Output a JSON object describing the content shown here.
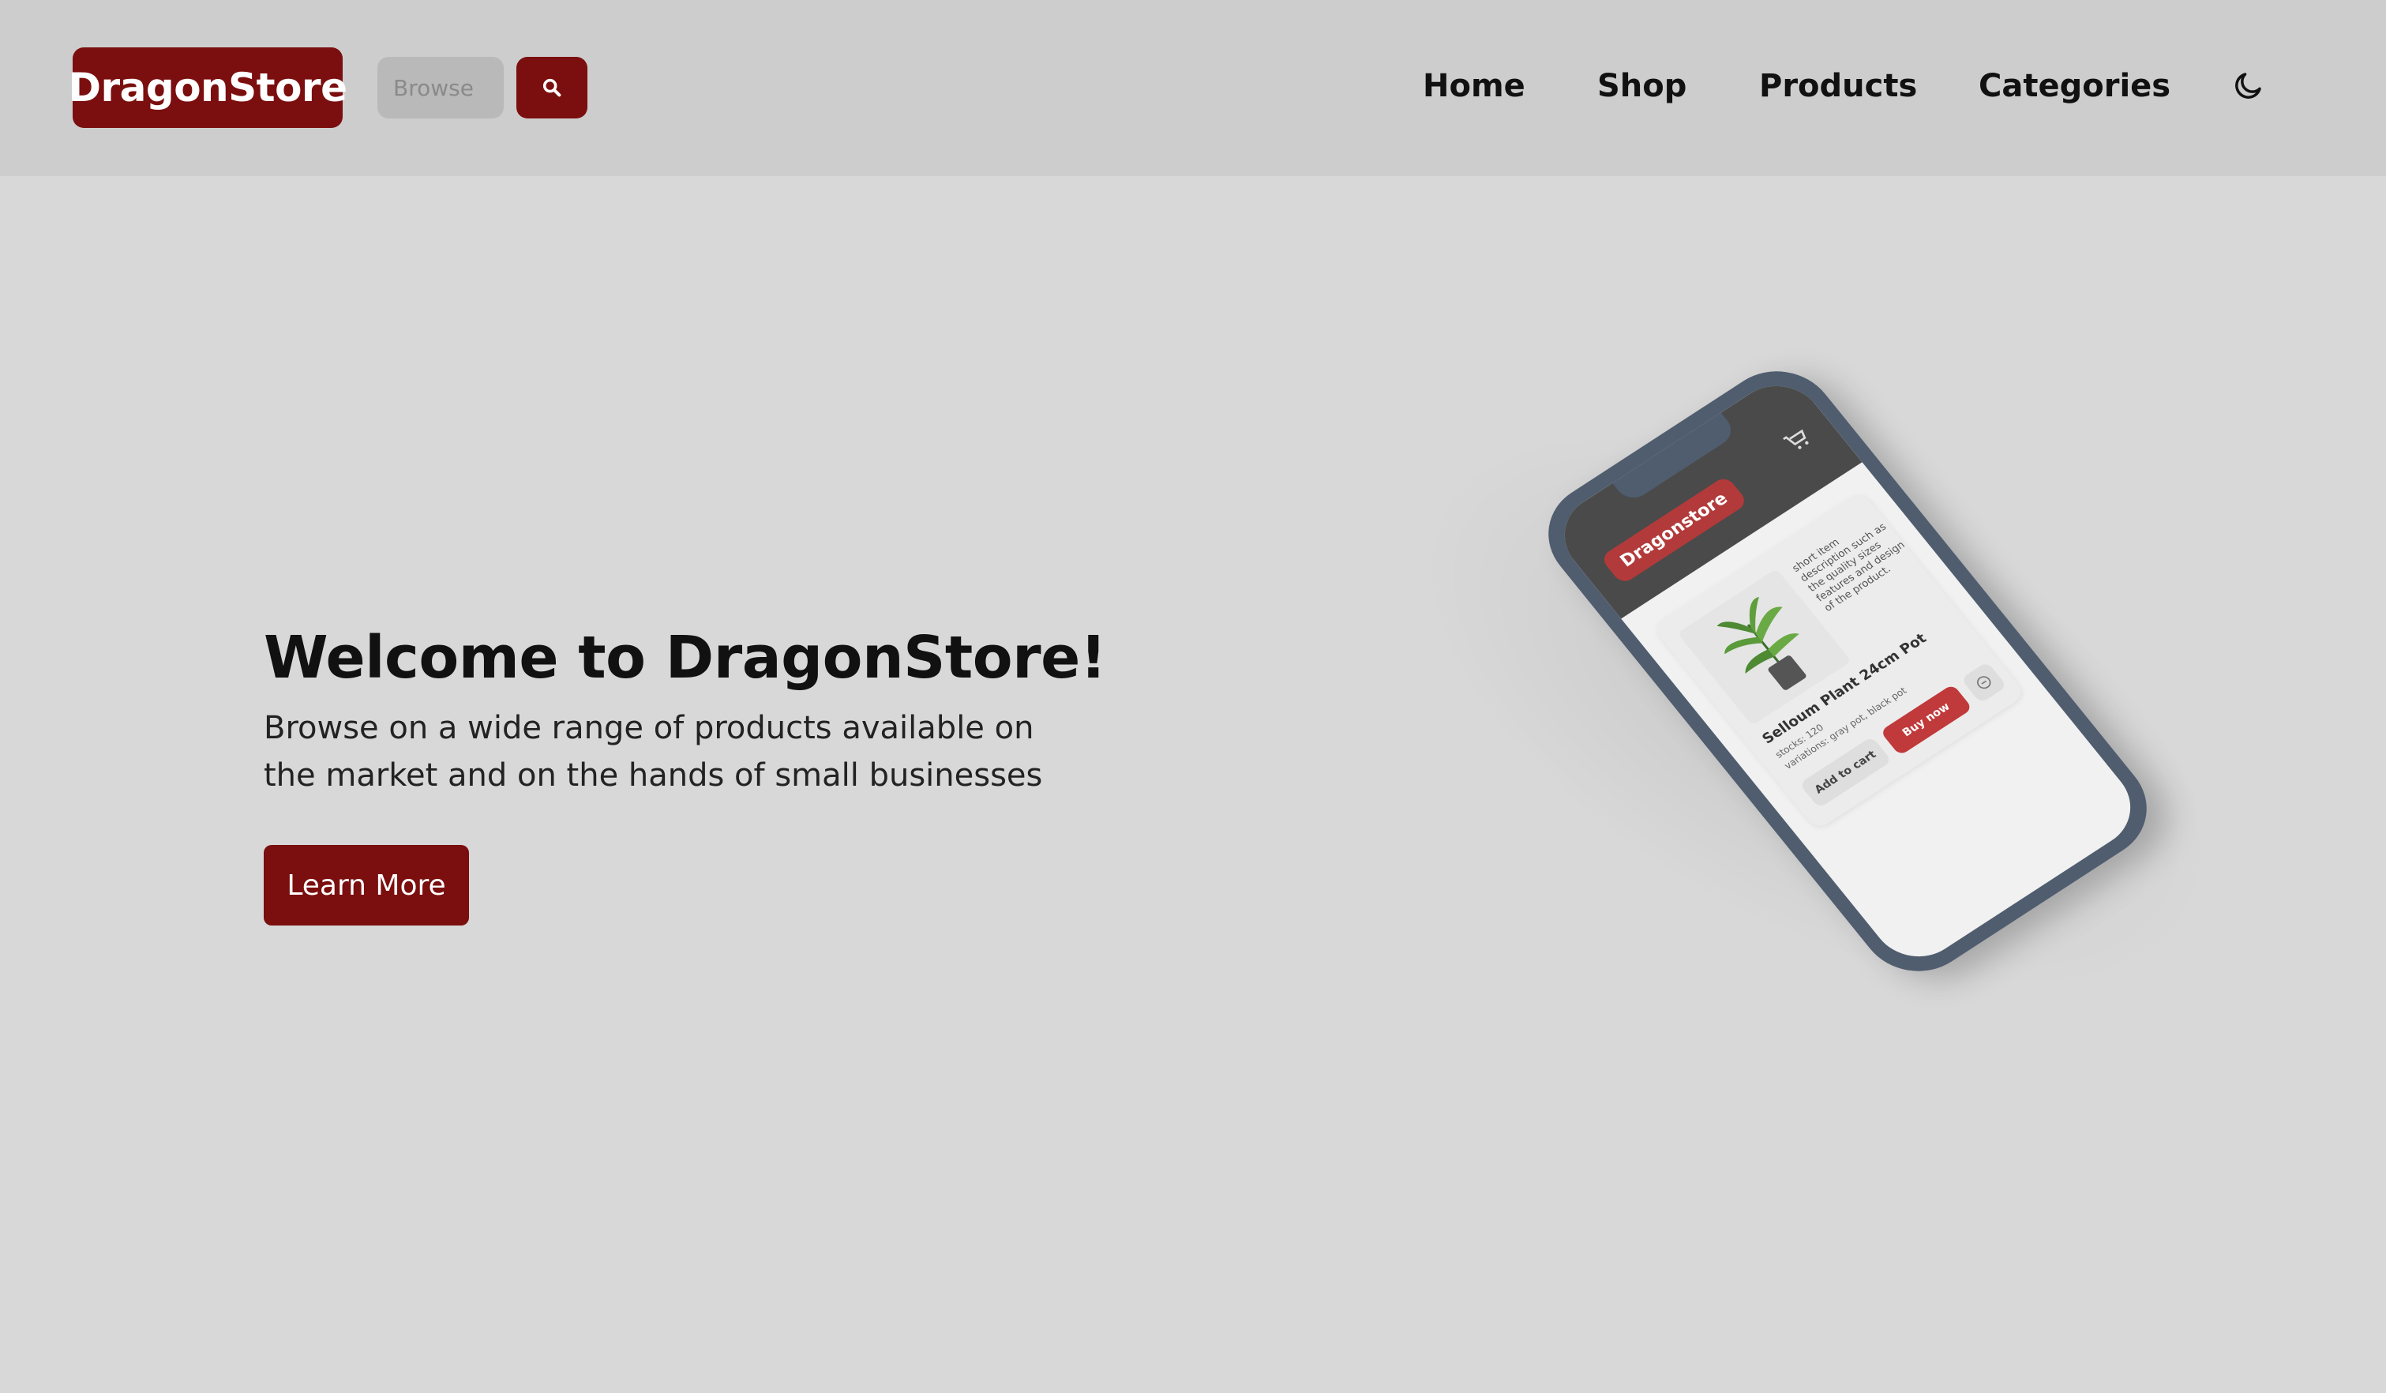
{
  "header": {
    "logo": "DragonStore",
    "search": {
      "placeholder": "Browse",
      "icon": "search-icon"
    },
    "nav": [
      {
        "label": "Home"
      },
      {
        "label": "Shop"
      },
      {
        "label": "Products"
      },
      {
        "label": "Categories"
      }
    ],
    "theme_toggle_icon": "moon-icon"
  },
  "hero": {
    "title": "Welcome to DragonStore!",
    "text": "Browse on a wide range of products available on the market and on the hands of small businesses",
    "cta_label": "Learn More"
  },
  "phone_mockup": {
    "logo": "Dragonstore",
    "cart_icon": "cart-icon",
    "card": {
      "description": "short item description such as the quality sizes features and design of the product.",
      "product_name": "Selloum Plant 24cm Pot",
      "stocks": "stocks: 120",
      "variations": "variations: gray pot, black pot",
      "add_to_cart": "Add to cart",
      "buy_now": "Buy now"
    }
  },
  "colors": {
    "accent": "#7b0e0e",
    "header_bg": "#cdcdcd",
    "page_bg": "#d8d8d8"
  }
}
